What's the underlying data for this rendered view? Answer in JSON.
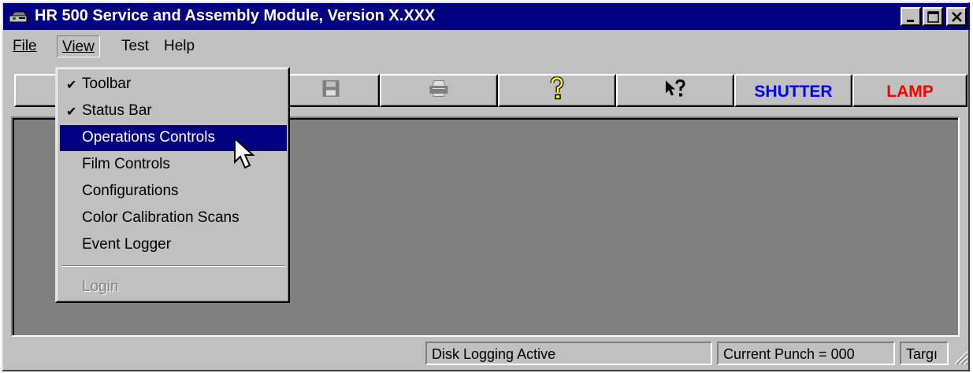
{
  "window": {
    "title": "HR 500 Service and Assembly Module, Version X.XXX",
    "icon": "app-icon"
  },
  "menubar": {
    "items": [
      {
        "label": "File",
        "access_key": "F"
      },
      {
        "label": "View",
        "access_key": "V",
        "open": true
      },
      {
        "label": "Test",
        "access_key": "T"
      },
      {
        "label": "Help",
        "access_key": "H"
      }
    ]
  },
  "toolbar": {
    "buttons": [
      {
        "name": "blank",
        "icon": "none"
      },
      {
        "name": "save",
        "icon": "floppy-disk-icon"
      },
      {
        "name": "print",
        "icon": "printer-icon"
      },
      {
        "name": "help",
        "icon": "question-mark-icon"
      },
      {
        "name": "context-help",
        "icon": "arrow-question-icon"
      },
      {
        "name": "shutter",
        "label": "SHUTTER",
        "color": "#0000ff"
      },
      {
        "name": "lamp",
        "label": "LAMP",
        "color": "#ff0000"
      }
    ]
  },
  "view_menu": {
    "items": [
      {
        "label": "Toolbar",
        "access_key": "T",
        "checked": true
      },
      {
        "label": "Status Bar",
        "access_key": "S",
        "checked": true
      },
      {
        "label": "Operations Controls",
        "access_key": "O",
        "selected": true
      },
      {
        "label": "Film Controls",
        "access_key": "F"
      },
      {
        "label": "Configurations",
        "access_key": "C"
      },
      {
        "label": "Color Calibration Scans",
        "access_key": "a"
      },
      {
        "label": "Event Logger",
        "access_key": "E"
      },
      {
        "label": "Login",
        "access_key": "L",
        "disabled": true
      }
    ]
  },
  "statusbar": {
    "disk_logging": "Disk Logging Active",
    "current_punch": "Current Punch = 000",
    "target": "Targı"
  },
  "colors": {
    "title_bar": "#000080",
    "selection": "#000080",
    "client_area": "#808080",
    "face": "#c0c0c0",
    "shutter_text": "#0000ff",
    "lamp_text": "#ff0000"
  }
}
